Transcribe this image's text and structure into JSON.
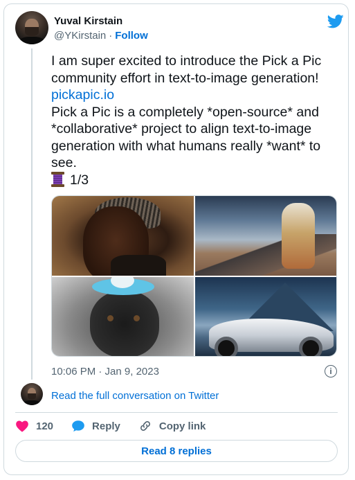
{
  "author": {
    "name": "Yuval Kirstain",
    "handle": "@YKirstain",
    "separator": "·",
    "follow_label": "Follow"
  },
  "tweet": {
    "line1": "I am super excited to introduce the Pick a Pic community effort in text-to-image generation!",
    "link": "pickapic.io",
    "line2": "Pick a Pic is a completely *open-source* and *collaborative* project to align text-to-image generation with what humans really *want* to see.",
    "thread_counter": "1/3",
    "thread_emoji_icon": "spool-of-thread-icon",
    "timestamp": "10:06 PM · Jan 9, 2023",
    "images": [
      "portrait-woman",
      "astronaut-landscape",
      "dog-with-hat",
      "sports-car-mountains"
    ]
  },
  "conversation_link": "Read the full conversation on Twitter",
  "actions": {
    "likes_count": "120",
    "reply_label": "Reply",
    "copy_link_label": "Copy link"
  },
  "read_replies_label": "Read 8 replies",
  "colors": {
    "link": "#006fd6",
    "heart": "#f91880",
    "twitter_blue": "#1d9bf0",
    "border": "#cfd9de",
    "muted_text": "#536471"
  }
}
